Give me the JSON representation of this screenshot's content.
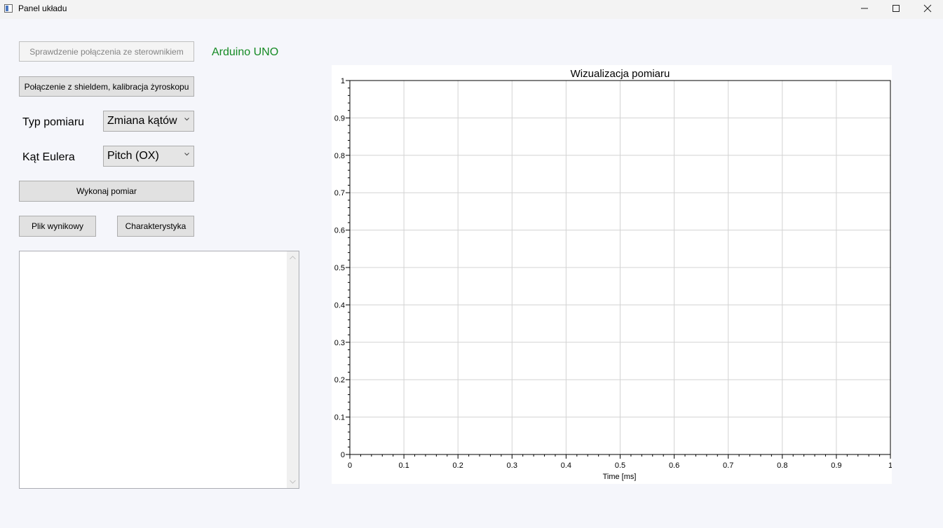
{
  "window": {
    "title": "Panel układu",
    "icon": "app-window-icon",
    "controls": [
      "minimize-icon",
      "maximize-icon",
      "close-icon"
    ]
  },
  "left_panel": {
    "check_connection_button": "Sprawdzenie połączenia ze sterownikiem",
    "check_connection_enabled": false,
    "controller_status": "Arduino UNO",
    "controller_status_color": "#158a24",
    "shield_button": "Połączenie z shieldem, kalibracja żyroskopu",
    "measurement_type_label": "Typ pomiaru",
    "measurement_type_value": "Zmiana kątów",
    "euler_angle_label": "Kąt Eulera",
    "euler_angle_value": "Pitch (OX)",
    "run_button": "Wykonaj pomiar",
    "result_file_button": "Plik wynikowy",
    "characteristic_button": "Charakterystyka",
    "output_text": ""
  },
  "chart_data": {
    "type": "line",
    "title": "Wizualizacja pomiaru",
    "xlabel": "Time [ms]",
    "ylabel": "",
    "xlim": [
      0,
      1
    ],
    "ylim": [
      0,
      1
    ],
    "x_ticks": [
      "0",
      "0.1",
      "0.2",
      "0.3",
      "0.4",
      "0.5",
      "0.6",
      "0.7",
      "0.8",
      "0.9",
      "1"
    ],
    "y_ticks": [
      "0",
      "0.1",
      "0.2",
      "0.3",
      "0.4",
      "0.5",
      "0.6",
      "0.7",
      "0.8",
      "0.9",
      "1"
    ],
    "grid": true,
    "series": []
  }
}
